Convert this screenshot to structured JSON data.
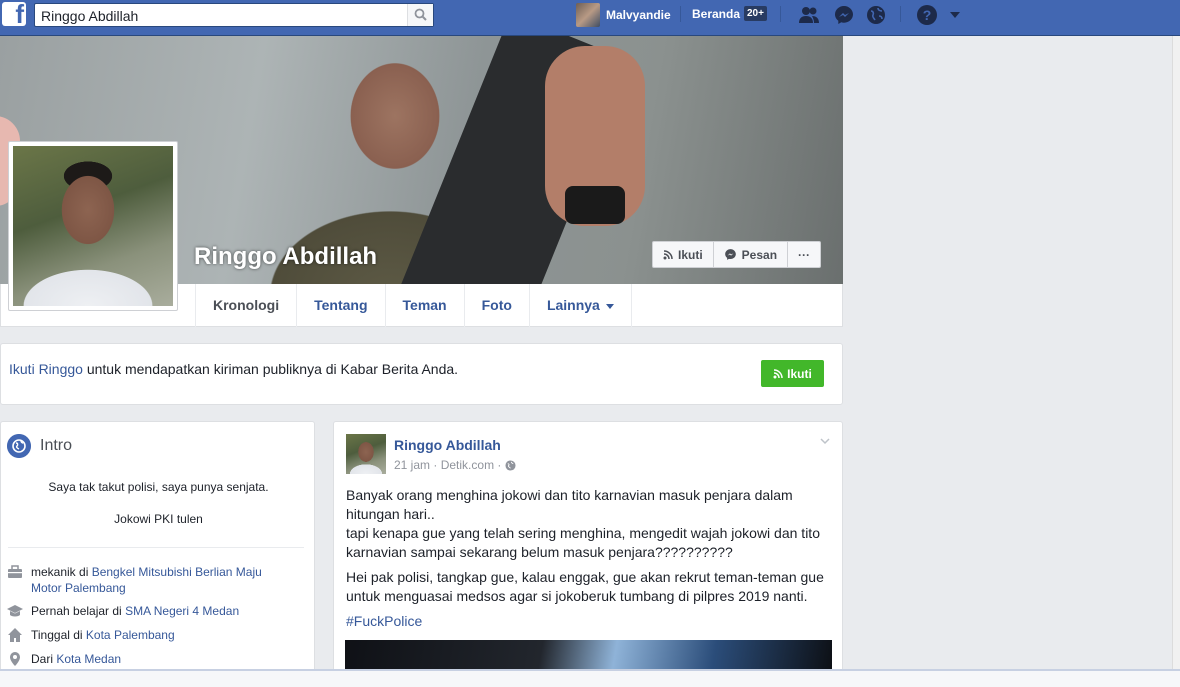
{
  "topbar": {
    "search_value": "Ringgo Abdillah",
    "user_name": "Malvyandie",
    "home_label": "Beranda",
    "home_badge": "20+"
  },
  "profile": {
    "name": "Ringgo Abdillah",
    "buttons": {
      "follow": "Ikuti",
      "message": "Pesan",
      "more": "···"
    },
    "tabs": [
      {
        "label": "Kronologi",
        "active": true
      },
      {
        "label": "Tentang"
      },
      {
        "label": "Teman"
      },
      {
        "label": "Foto"
      },
      {
        "label": "Lainnya"
      }
    ]
  },
  "follow_prompt": {
    "link": "Ikuti Ringgo",
    "text": " untuk mendapatkan kiriman publiknya di Kabar Berita Anda.",
    "button": "Ikuti"
  },
  "intro": {
    "title": "Intro",
    "bio_line1": "Saya tak takut polisi, saya punya senjata.",
    "bio_line2": "Jokowi PKI tulen",
    "work_prefix": "mekanik di ",
    "work_place": "Bengkel Mitsubishi Berlian Maju Motor Palembang",
    "edu_prefix": "Pernah belajar di ",
    "edu_place": "SMA Negeri 4 Medan",
    "lives_prefix": "Tinggal di ",
    "lives_place": "Kota Palembang",
    "from_prefix": "Dari ",
    "from_place": "Kota Medan"
  },
  "post": {
    "author": "Ringgo Abdillah",
    "time": "21 jam",
    "dot": "·",
    "source": "Detik.com",
    "dot2": "·",
    "para1": "Banyak orang menghina jokowi dan tito karnavian masuk penjara dalam hitungan hari..",
    "para1b": "tapi kenapa gue yang telah sering menghina, mengedit wajah jokowi dan tito karnavian sampai sekarang belum masuk penjara??????????",
    "para2": "Hei pak polisi, tangkap gue, kalau enggak, gue akan rekrut teman-teman gue untuk menguasai medsos agar si jokoberuk tumbang di pilpres 2019 nanti.",
    "hashtag": "#FuckPolice"
  },
  "colors": {
    "fb_blue": "#4267b2",
    "link": "#365899",
    "green": "#42b72a"
  }
}
